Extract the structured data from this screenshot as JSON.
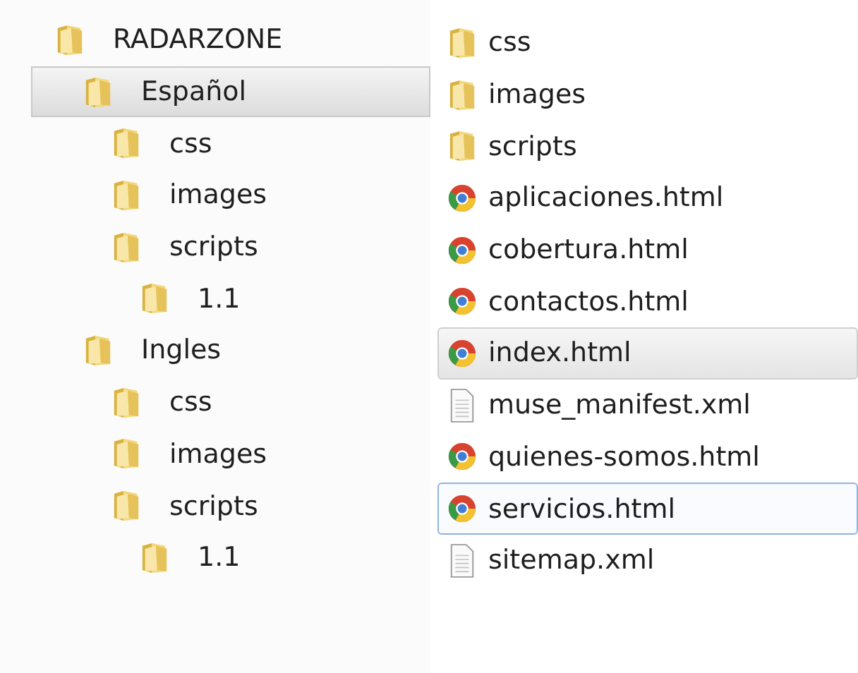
{
  "tree": [
    {
      "label": "RADARZONE",
      "selected": false,
      "children": [
        {
          "label": "Español",
          "selected": true,
          "children": [
            {
              "label": "css",
              "selected": false
            },
            {
              "label": "images",
              "selected": false
            },
            {
              "label": "scripts",
              "selected": false,
              "children": [
                {
                  "label": "1.1",
                  "selected": false
                }
              ]
            }
          ]
        },
        {
          "label": "Ingles",
          "selected": false,
          "children": [
            {
              "label": "css",
              "selected": false
            },
            {
              "label": "images",
              "selected": false
            },
            {
              "label": "scripts",
              "selected": false,
              "children": [
                {
                  "label": "1.1",
                  "selected": false
                }
              ]
            }
          ]
        }
      ]
    }
  ],
  "files": [
    {
      "name": "css",
      "kind": "folder",
      "selected": false,
      "focused": false
    },
    {
      "name": "images",
      "kind": "folder",
      "selected": false,
      "focused": false
    },
    {
      "name": "scripts",
      "kind": "folder",
      "selected": false,
      "focused": false
    },
    {
      "name": "aplicaciones.html",
      "kind": "chrome",
      "selected": false,
      "focused": false
    },
    {
      "name": "cobertura.html",
      "kind": "chrome",
      "selected": false,
      "focused": false
    },
    {
      "name": "contactos.html",
      "kind": "chrome",
      "selected": false,
      "focused": false
    },
    {
      "name": "index.html",
      "kind": "chrome",
      "selected": true,
      "focused": false
    },
    {
      "name": "muse_manifest.xml",
      "kind": "file",
      "selected": false,
      "focused": false
    },
    {
      "name": "quienes-somos.html",
      "kind": "chrome",
      "selected": false,
      "focused": false
    },
    {
      "name": "servicios.html",
      "kind": "chrome",
      "selected": false,
      "focused": true
    },
    {
      "name": "sitemap.xml",
      "kind": "file",
      "selected": false,
      "focused": false
    }
  ]
}
